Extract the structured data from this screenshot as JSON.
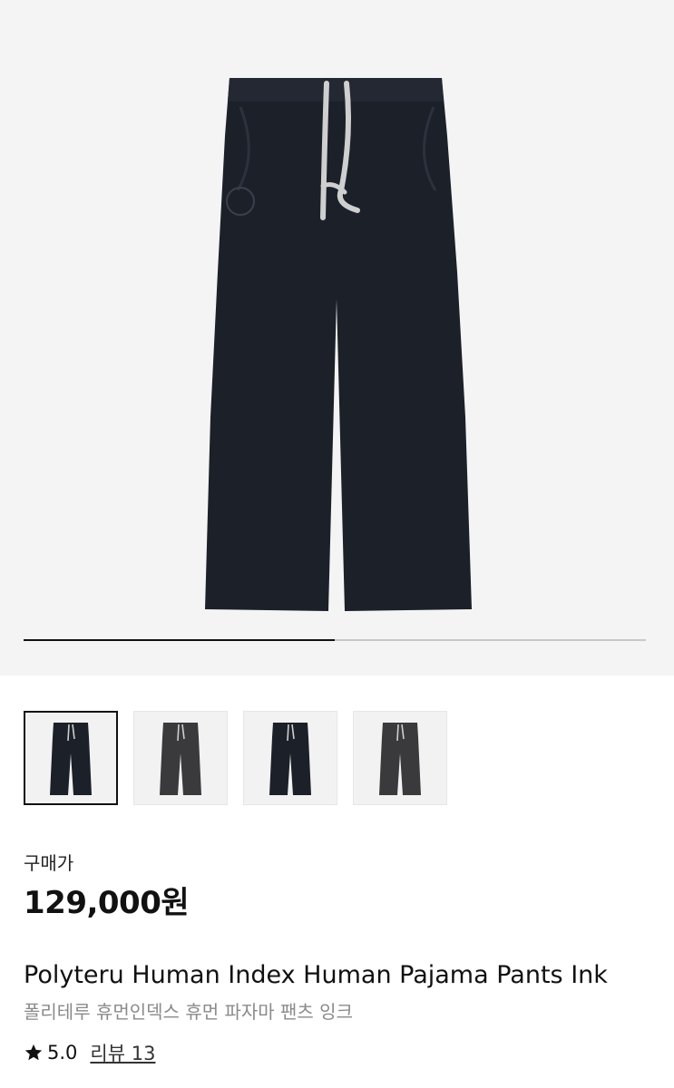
{
  "gallery": {
    "progress_fraction": 0.5,
    "thumbnails": [
      {
        "alt": "pants-ink",
        "color": "#1c2029",
        "selected": true
      },
      {
        "alt": "pants-charcoal",
        "color": "#3a3a3c",
        "selected": false
      },
      {
        "alt": "pants-ink-2",
        "color": "#1c2029",
        "selected": false
      },
      {
        "alt": "pants-charcoal-2",
        "color": "#3a3a3c",
        "selected": false
      }
    ]
  },
  "product": {
    "price_label": "구매가",
    "price": "129,000원",
    "name_en": "Polyteru Human Index Human Pajama Pants Ink",
    "name_ko": "폴리테루 휴먼인덱스 휴먼 파자마 팬츠 잉크",
    "rating": "5.0",
    "review_label": "리뷰 13",
    "star_icon": "star-icon"
  },
  "colors": {
    "hero_bg": "#f4f4f4",
    "pants_ink": "#1c2029",
    "drawstring": "#cfcfcf"
  }
}
